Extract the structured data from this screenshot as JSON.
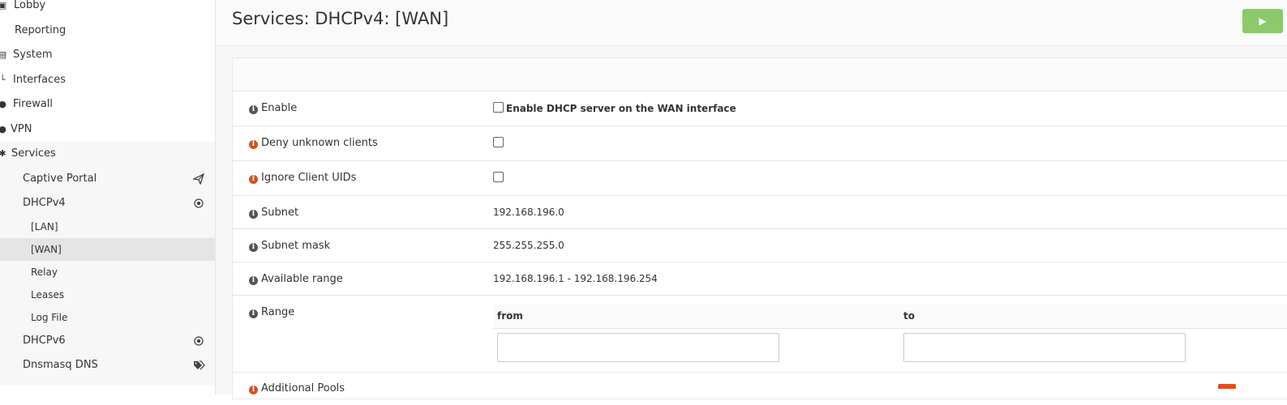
{
  "sidebar": {
    "items": [
      {
        "label": "Lobby",
        "icon": "laptop-icon"
      },
      {
        "label": "Reporting",
        "icon": "chart-icon"
      },
      {
        "label": "System",
        "icon": "server-icon"
      },
      {
        "label": "Interfaces",
        "icon": "sitemap-icon"
      },
      {
        "label": "Firewall",
        "icon": "fire-icon"
      },
      {
        "label": "VPN",
        "icon": "globe-icon"
      },
      {
        "label": "Services",
        "icon": "gears-icon"
      }
    ],
    "services": [
      {
        "label": "Captive Portal",
        "icon": "paper-plane-icon"
      },
      {
        "label": "DHCPv4",
        "icon": "bullseye-icon"
      },
      {
        "label": "DHCPv6",
        "icon": "bullseye-icon"
      },
      {
        "label": "Dnsmasq DNS",
        "icon": "tags-icon"
      }
    ],
    "dhcpv4_sub": [
      "[LAN]",
      "[WAN]",
      "Relay",
      "Leases",
      "Log File"
    ]
  },
  "header": {
    "title": "Services: DHCPv4: [WAN]",
    "apply_icon": "play-icon"
  },
  "form": {
    "enable": {
      "label": "Enable",
      "checkbox_label": "Enable DHCP server on the WAN interface",
      "checked": false
    },
    "deny_unknown": {
      "label": "Deny unknown clients",
      "checked": false
    },
    "ignore_uids": {
      "label": "Ignore Client UIDs",
      "checked": false
    },
    "subnet": {
      "label": "Subnet",
      "value": "192.168.196.0"
    },
    "subnet_mask": {
      "label": "Subnet mask",
      "value": "255.255.255.0"
    },
    "available_range": {
      "label": "Available range",
      "value": "192.168.196.1 - 192.168.196.254"
    },
    "range": {
      "label": "Range",
      "from_label": "from",
      "to_label": "to",
      "from_value": "",
      "to_value": ""
    },
    "additional_pools": {
      "label": "Additional Pools"
    }
  },
  "colors": {
    "accent_green": "#8bc96b",
    "warn_orange": "#d4501c"
  }
}
